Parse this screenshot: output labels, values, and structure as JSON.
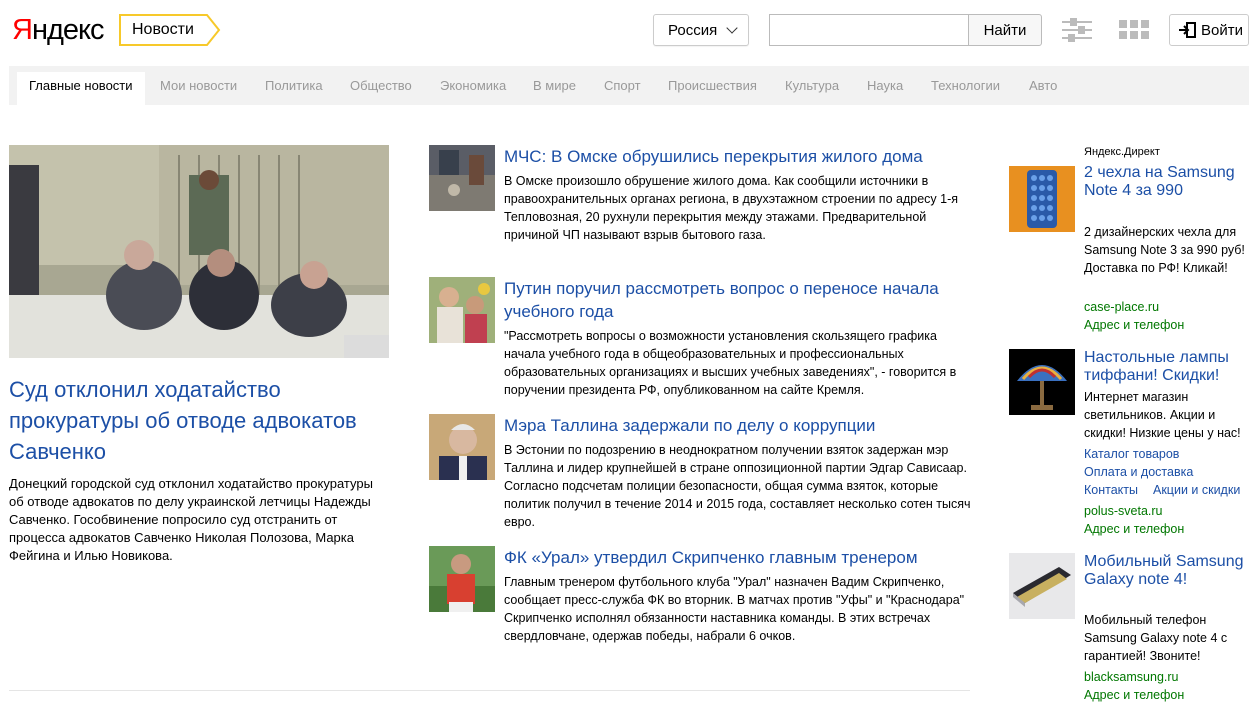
{
  "header": {
    "logo_first": "Я",
    "logo_rest": "ндекс",
    "service": "Новости",
    "region": "Россия",
    "search_placeholder": "",
    "search_button": "Найти",
    "login": "Войти"
  },
  "nav": {
    "tabs": [
      {
        "label": "Главные новости",
        "active": true
      },
      {
        "label": "Мои новости"
      },
      {
        "label": "Политика"
      },
      {
        "label": "Общество"
      },
      {
        "label": "Экономика"
      },
      {
        "label": "В мире"
      },
      {
        "label": "Спорт"
      },
      {
        "label": "Происшествия"
      },
      {
        "label": "Культура"
      },
      {
        "label": "Наука"
      },
      {
        "label": "Технологии"
      },
      {
        "label": "Авто"
      }
    ]
  },
  "main_story": {
    "title": "Суд отклонил ходатайство прокуратуры об отводе адвокатов Савченко",
    "text": "Донецкий городской суд отклонил ходатайство прокуратуры об отводе адвокатов по делу украинской летчицы Надежды Савченко. Гособвинение попросило суд отстранить от процесса адвокатов Савченко Николая Полозова, Марка Фейгина и Илью Новикова."
  },
  "news": [
    {
      "title": "МЧС: В Омске обрушились перекрытия жилого дома",
      "text": "В Омске произошло обрушение жилого дома. Как сообщили источники в правоохранительных органах региона, в двухэтажном строении по адресу 1-я Тепловозная, 20 рухнули перекрытия между этажами. Предварительной причиной ЧП называют взрыв бытового газа."
    },
    {
      "title": "Путин поручил рассмотреть вопрос о переносе начала учебного года",
      "text": "\"Рассмотреть вопросы о возможности установления скользящего графика начала учебного года в общеобразовательных и профессиональных образовательных организациях и высших учебных заведениях\", - говорится в поручении президента РФ, опубликованном на сайте Кремля."
    },
    {
      "title": "Мэра Таллина задержали по делу о коррупции",
      "text": "В Эстонии по подозрению в неоднократном получении взяток задержан мэр Таллина и лидер крупнейшей в стране оппозиционной партии Эдгар Сависаар. Согласно подсчетам полиции безопасности, общая сумма взяток, которые политик получил в течение 2014 и 2015 года, составляет несколько сотен тысяч евро."
    },
    {
      "title": "ФК «Урал» утвердил Скрипченко главным тренером",
      "text": "Главным тренером футбольного клуба \"Урал\" назначен Вадим Скрипченко, сообщает пресс-служба ФК во вторник. В матчах против \"Уфы\" и \"Краснодара\" Скрипченко исполнял обязанности наставника команды. В этих встречах свердловчане, одержав победы, набрали 6 очков."
    }
  ],
  "direct": {
    "label": "Яндекс.Директ",
    "ads": [
      {
        "title": "2 чехла на Samsung Note 4 за 990",
        "text": "2 дизайнерских чехла для Samsung Note 3 за 990 руб! Доставка по РФ! Кликай!",
        "domain": "case-place.ru",
        "addr": "Адрес и телефон"
      },
      {
        "title": "Настольные лампы тиффани! Скидки!",
        "text": "Интернет магазин светильников. Акции и скидки! Низкие цены у нас!",
        "links": [
          "Каталог товаров",
          "Оплата и доставка",
          "Контакты",
          "Акции и скидки"
        ],
        "domain": "polus-sveta.ru",
        "addr": "Адрес и телефон"
      },
      {
        "title": "Мобильный Samsung Galaxy note 4!",
        "text": "Мобильный телефон Samsung Galaxy note 4 с гарантией! Звоните!",
        "domain": "blacksamsung.ru",
        "addr": "Адрес и телефон"
      }
    ]
  }
}
